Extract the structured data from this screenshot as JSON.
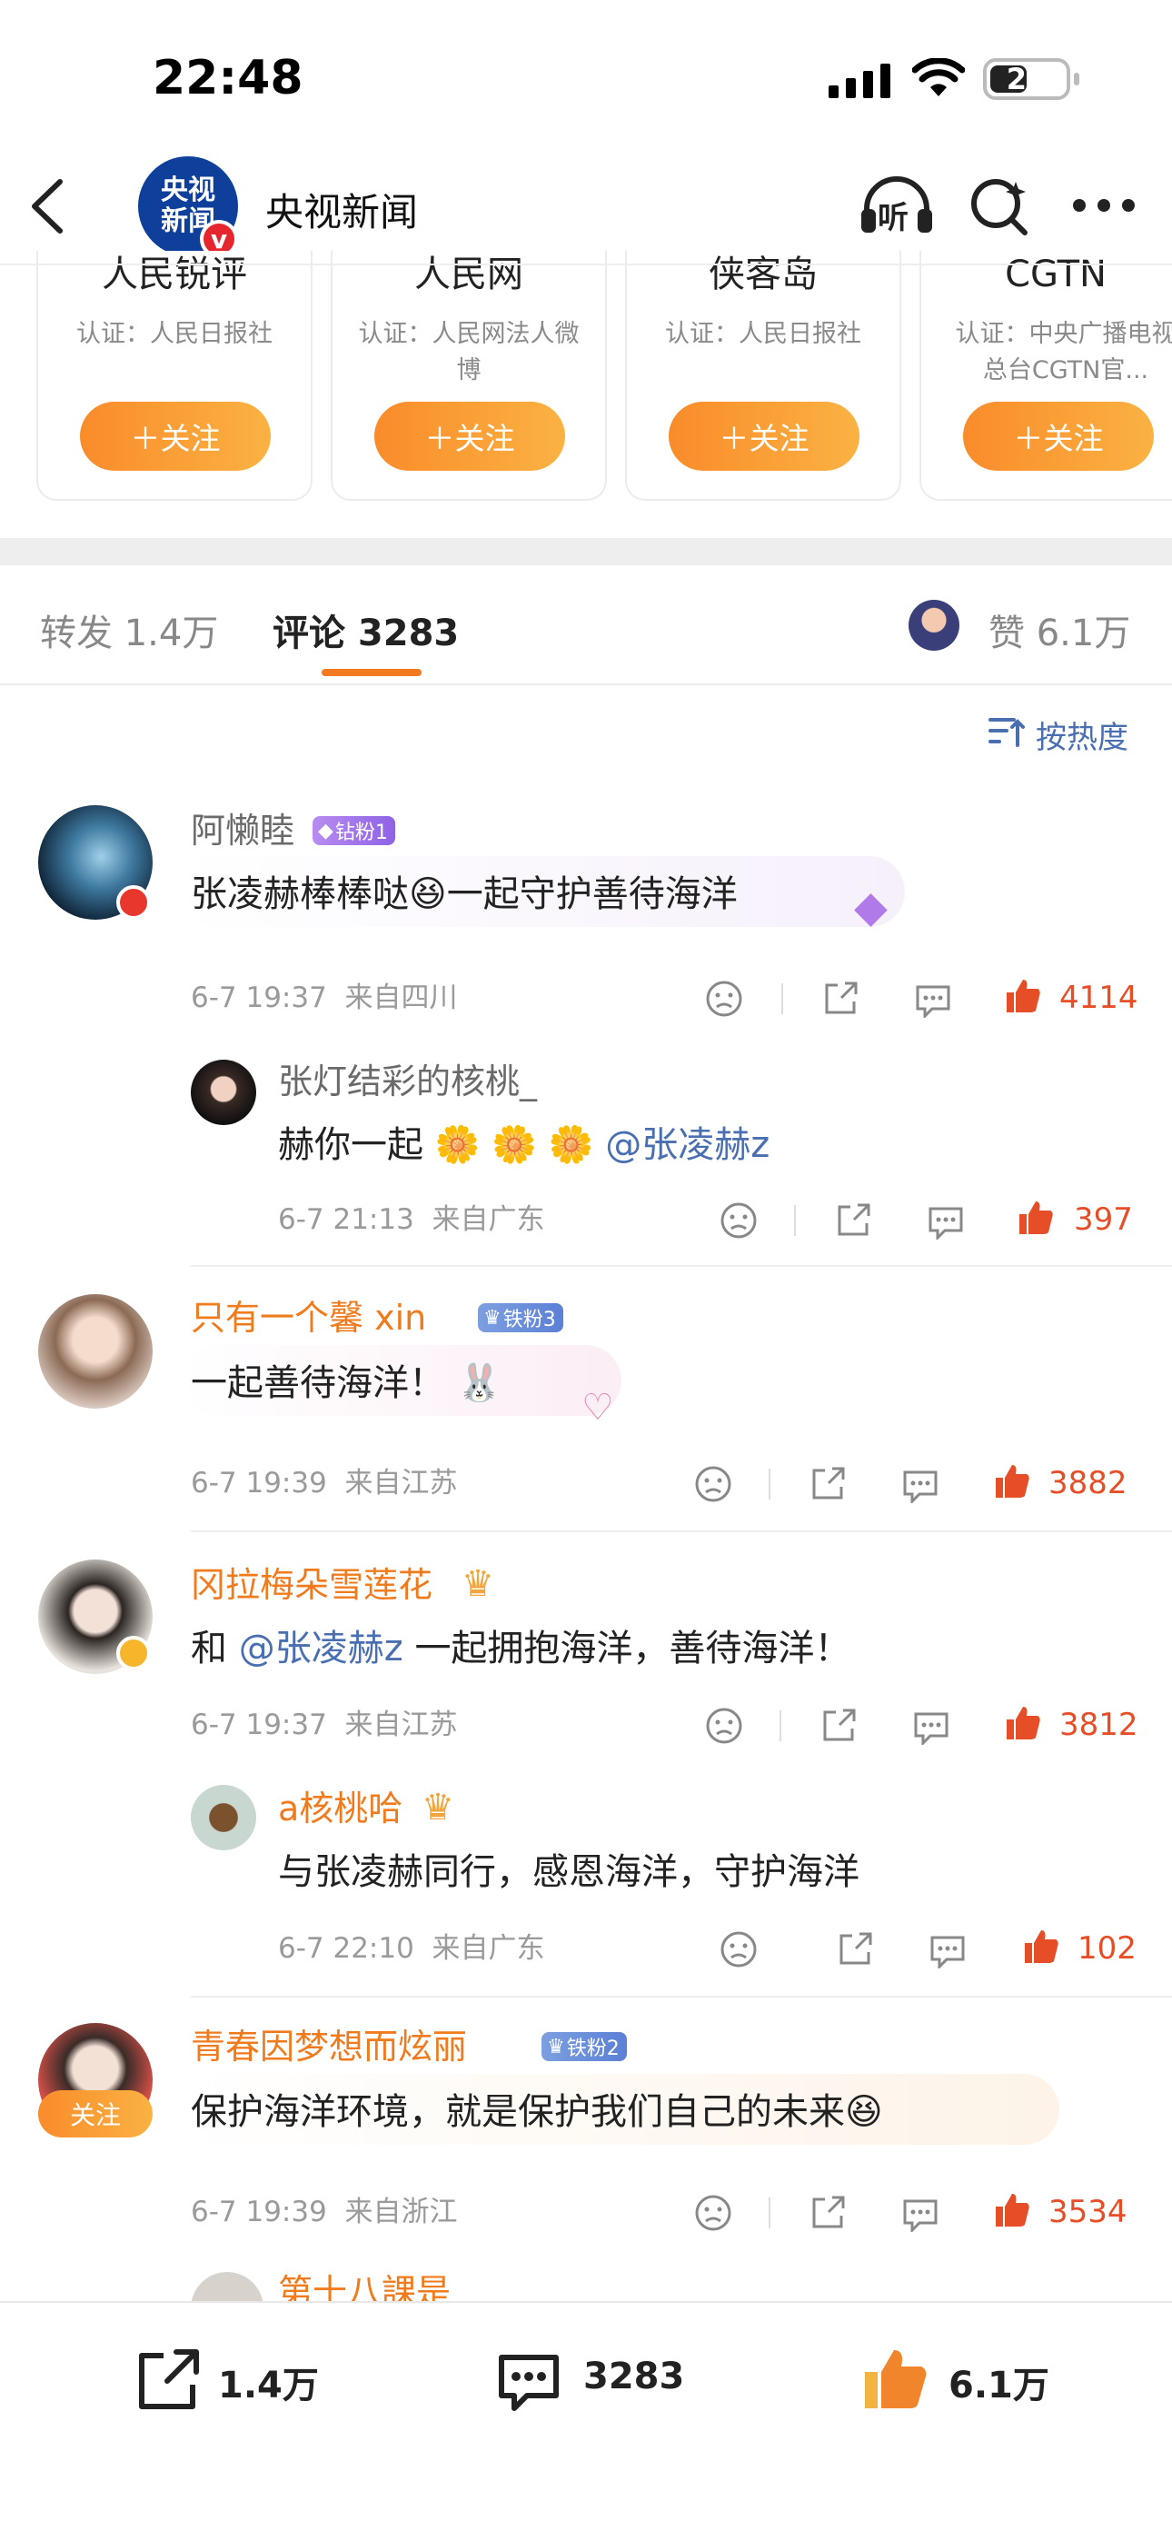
{
  "status": {
    "time": "22:48",
    "battery": "22"
  },
  "header": {
    "avatar_line1": "央视",
    "avatar_line2": "新闻",
    "title": "央视新闻",
    "listen": "听"
  },
  "recommend": [
    {
      "name": "人民锐评",
      "cert": "认证：人民日报社",
      "follow": "＋关注"
    },
    {
      "name": "人民网",
      "cert": "认证：人民网法人微博",
      "follow": "＋关注"
    },
    {
      "name": "侠客岛",
      "cert": "认证：人民日报社",
      "follow": "＋关注"
    },
    {
      "name": "CGTN",
      "cert": "认证：中央广播电视总台CGTN官...",
      "follow": "＋关注"
    }
  ],
  "tabs": {
    "forward": "转发 1.4万",
    "comments": "评论 3283",
    "likes": "赞 6.1万"
  },
  "sort": {
    "label": "按热度"
  },
  "comments": [
    {
      "user": "阿懒睦",
      "badge": "钻粉1",
      "text_a": "张凌赫棒棒哒",
      "text_b": "一起守护善待海洋",
      "time": "6-7 19:37",
      "loc": "来自四川",
      "likes": "4114",
      "replies": [
        {
          "user": "张灯结彩的核桃_",
          "text": "赫你一起",
          "mention": "@张凌赫z",
          "time": "6-7 21:13",
          "loc": "来自广东",
          "likes": "397"
        }
      ]
    },
    {
      "user": "只有一个馨 xin",
      "badge": "铁粉3",
      "text": "一起善待海洋！",
      "time": "6-7 19:39",
      "loc": "来自江苏",
      "likes": "3882"
    },
    {
      "user": "冈拉梅朵雪莲花",
      "text_a": "和",
      "mention": "@张凌赫z",
      "text_b": "一起拥抱海洋，善待海洋！",
      "time": "6-7 19:37",
      "loc": "来自江苏",
      "likes": "3812",
      "replies": [
        {
          "user": "a核桃哈",
          "text": "与张凌赫同行，感恩海洋，守护海洋",
          "time": "6-7 22:10",
          "loc": "来自广东",
          "likes": "102"
        }
      ]
    },
    {
      "user": "青春因梦想而炫丽",
      "badge": "铁粉2",
      "follow": "关注",
      "text": "保护海洋环境，就是保护我们自己的未来",
      "time": "6-7 19:39",
      "loc": "来自浙江",
      "likes": "3534"
    },
    {
      "user": "第十八課是"
    }
  ],
  "bottom": {
    "forward": "1.4万",
    "comments": "3283",
    "likes": "6.1万"
  },
  "colors": {
    "accent": "#f47a1f",
    "like": "#e54e27",
    "mention": "#4a6fb0",
    "orange_name": "#f07b1d"
  }
}
